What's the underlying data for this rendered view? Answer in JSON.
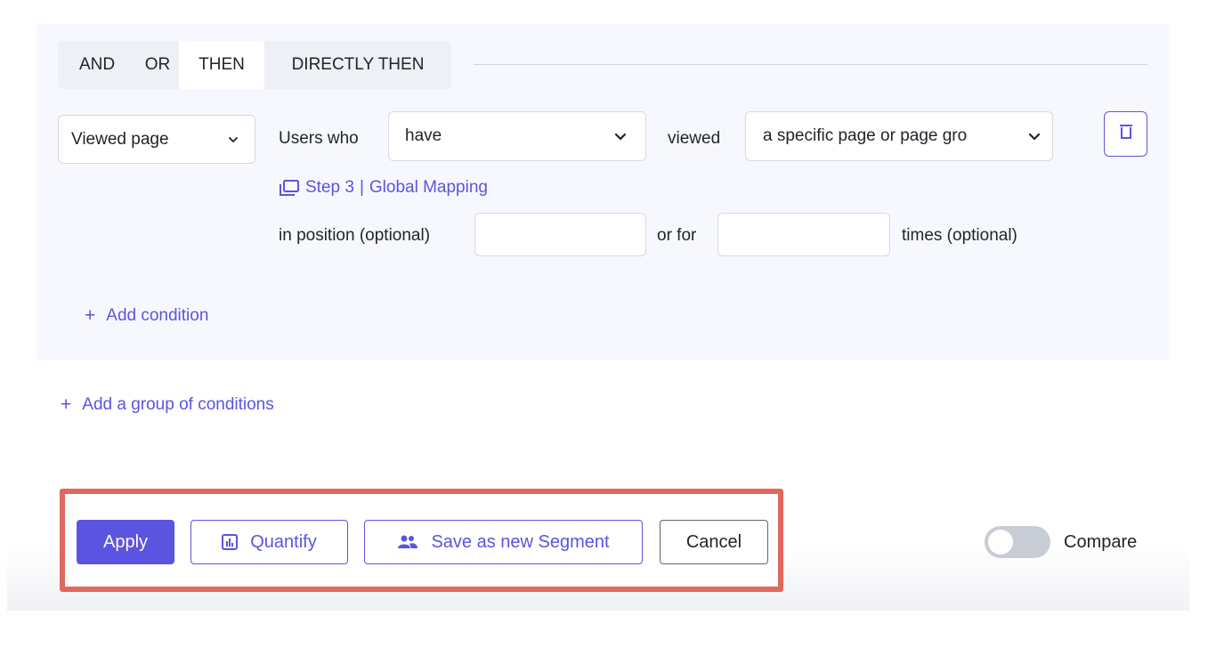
{
  "operators": [
    {
      "label": "AND",
      "active": false
    },
    {
      "label": "OR",
      "active": false
    },
    {
      "label": "THEN",
      "active": true
    },
    {
      "label": "DIRECTLY THEN",
      "active": false
    }
  ],
  "condition": {
    "event_type": "Viewed page",
    "users_who_label": "Users who",
    "have_value": "have",
    "viewed_label": "viewed",
    "page_value": "a specific page or page gro",
    "step_link": {
      "step": "Step 3",
      "mapping": "Global Mapping"
    },
    "position_label": "in position (optional)",
    "position_value": "",
    "or_for_label": "or for",
    "times_value": "",
    "times_label": "times (optional)"
  },
  "add_condition_label": "Add condition",
  "add_group_label": "Add a group of conditions",
  "footer": {
    "apply_label": "Apply",
    "quantify_label": "Quantify",
    "save_segment_label": "Save as new Segment",
    "cancel_label": "Cancel",
    "compare_label": "Compare",
    "compare_on": false
  },
  "colors": {
    "accent": "#5b54e0",
    "highlight": "#e0685e",
    "panel_bg": "#f7f8fd"
  }
}
